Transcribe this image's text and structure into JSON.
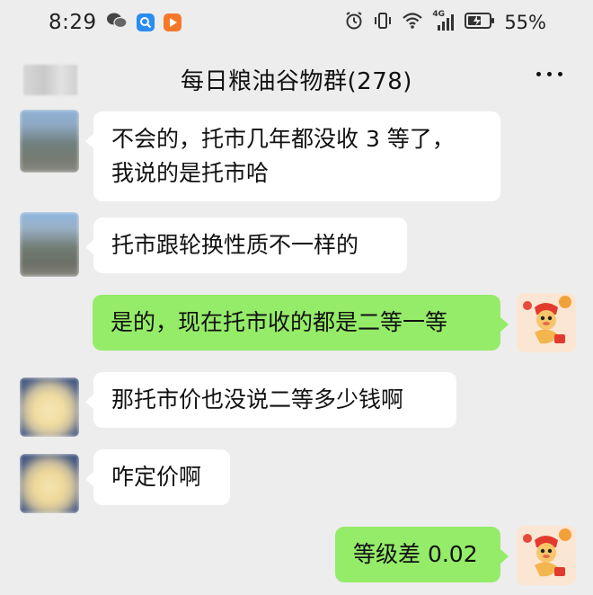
{
  "status_bar": {
    "time": "8:29",
    "battery": "55%",
    "network": "4G",
    "icons": [
      "wechat-icon",
      "search-app-icon",
      "video-app-icon",
      "alarm-icon",
      "vibrate-icon",
      "wifi-icon",
      "signal-icon",
      "battery-icon"
    ]
  },
  "header": {
    "title": "每日粮油谷物群(278)"
  },
  "colors": {
    "background": "#ededed",
    "received_bubble": "#ffffff",
    "sent_bubble": "#95ec69"
  },
  "messages": [
    {
      "side": "left",
      "lines": [
        "不会的，托市几年都没收 3 等了，",
        "我说的是托市哈"
      ]
    },
    {
      "side": "left",
      "lines": [
        "托市跟轮换性质不一样的"
      ]
    },
    {
      "side": "right",
      "lines": [
        "是的，现在托市收的都是二等一等"
      ]
    },
    {
      "side": "left",
      "lines": [
        "那托市价也没说二等多少钱啊"
      ]
    },
    {
      "side": "left",
      "lines": [
        "咋定价啊"
      ]
    },
    {
      "side": "right",
      "lines": [
        "等级差 0.02"
      ]
    }
  ]
}
